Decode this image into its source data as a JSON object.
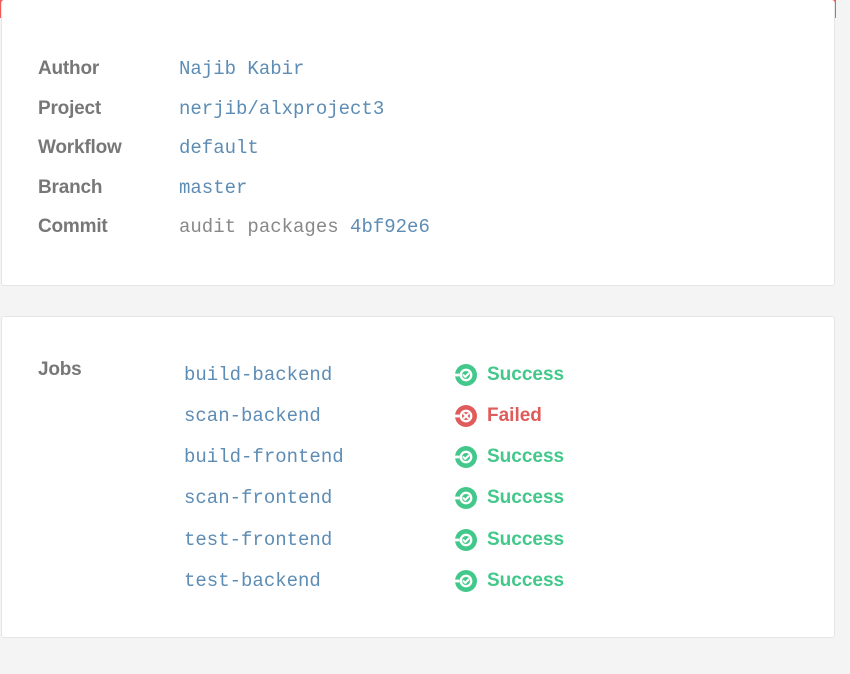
{
  "details": [
    {
      "label": "Author",
      "value": "Najib Kabir"
    },
    {
      "label": "Project",
      "value": "nerjib/alxproject3"
    },
    {
      "label": "Workflow",
      "value": "default"
    },
    {
      "label": "Branch",
      "value": "master"
    }
  ],
  "commit": {
    "label": "Commit",
    "message": "audit packages",
    "hash": "4bf92e6"
  },
  "jobs": {
    "label": "Jobs",
    "items": [
      {
        "name": "build-backend",
        "status": "Success",
        "icon": "success-icon"
      },
      {
        "name": "scan-backend",
        "status": "Failed",
        "icon": "failed-icon"
      },
      {
        "name": "build-frontend",
        "status": "Success",
        "icon": "success-icon"
      },
      {
        "name": "scan-frontend",
        "status": "Success",
        "icon": "success-icon"
      },
      {
        "name": "test-frontend",
        "status": "Success",
        "icon": "success-icon"
      },
      {
        "name": "test-backend",
        "status": "Success",
        "icon": "success-icon"
      }
    ]
  },
  "colors": {
    "header_bar": "#ef5b5b",
    "success": "#42c88a",
    "failed": "#e05b5b",
    "link": "#5d8cb4",
    "label": "#777777"
  }
}
